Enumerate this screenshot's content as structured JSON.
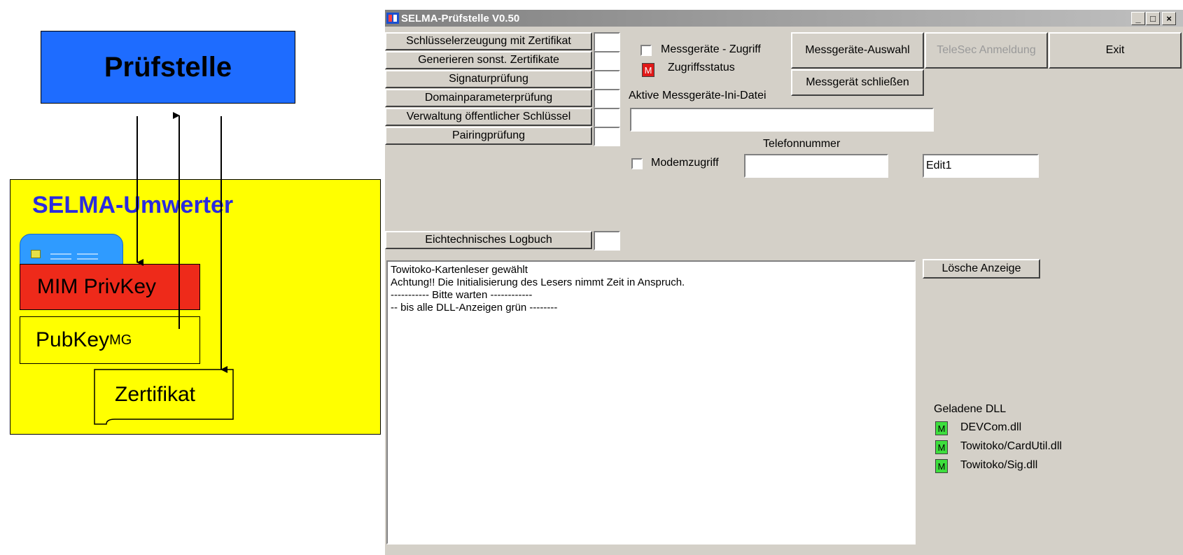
{
  "diagram": {
    "pruefstelle": "Prüfstelle",
    "umwerter": "SELMA-Umwerter",
    "privkey": "MIM PrivKey",
    "pubkey": "PubKey",
    "pubkey_sub": "MG",
    "zertifikat": "Zertifikat",
    "icons": [
      "smartcard-icon"
    ]
  },
  "window": {
    "title": "SELMA-Prüfstelle V0.50",
    "controls": {
      "minimize": "_",
      "maximize": "□",
      "close": "×"
    }
  },
  "left_buttons": [
    "Schlüsselerzeugung mit Zertifikat",
    "Generieren sonst. Zertifikate",
    "Signaturprüfung",
    "Domainparameterprüfung",
    "Verwaltung öffentlicher Schlüssel",
    "Pairingprüfung"
  ],
  "logbuch_button": "Eichtechnisches Logbuch",
  "messgeraete_zugriff": "Messgeräte - Zugriff",
  "zugriffsstatus": "Zugriffsstatus",
  "zugriffsstatus_led": "M",
  "messgeraete_auswahl": "Messgeräte-Auswahl",
  "messgeraet_schliessen": "Messgerät schließen",
  "telesec_anmeldung": "TeleSec Anmeldung",
  "exit": "Exit",
  "ini_label": "Aktive Messgeräte-Ini-Datei",
  "ini_value": "",
  "telefon_label": "Telefonnummer",
  "telefon_value": "",
  "modemzugriff": "Modemzugriff",
  "edit1": "Edit1",
  "loesche_anzeige": "Lösche Anzeige",
  "log_lines": [
    "Towitoko-Kartenleser gewählt",
    "Achtung!! Die Initialisierung des Lesers nimmt Zeit in Anspruch.",
    "----------- Bitte warten ------------",
    "-- bis alle DLL-Anzeigen grün --------"
  ],
  "dll": {
    "heading": "Geladene DLL",
    "items": [
      {
        "led": "M",
        "name": "DEVCom.dll"
      },
      {
        "led": "M",
        "name": "Towitoko/CardUtil.dll"
      },
      {
        "led": "M",
        "name": "Towitoko/Sig.dll"
      }
    ]
  },
  "colors": {
    "pruefstelle_bg": "#1e6cff",
    "umwerter_bg": "#ffff00",
    "privkey_bg": "#ee2a1a",
    "umwerter_text": "#2a2ae0",
    "led_green": "#3dde3d",
    "led_red": "#e01818"
  }
}
